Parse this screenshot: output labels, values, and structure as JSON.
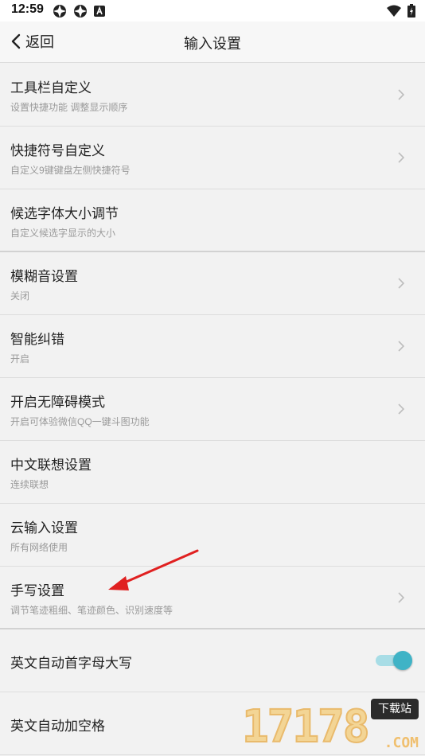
{
  "status_bar": {
    "time": "12:59"
  },
  "nav": {
    "back_label": "返回",
    "title": "输入设置"
  },
  "rows": [
    {
      "title": "工具栏自定义",
      "subtitle": "设置快捷功能 调整显示顺序"
    },
    {
      "title": "快捷符号自定义",
      "subtitle": "自定义9键键盘左侧快捷符号"
    },
    {
      "title": "候选字体大小调节",
      "subtitle": "自定义候选字显示的大小"
    },
    {
      "title": "模糊音设置",
      "subtitle": "关闭"
    },
    {
      "title": "智能纠错",
      "subtitle": "开启"
    },
    {
      "title": "开启无障碍模式",
      "subtitle": "开启可体验微信QQ一键斗图功能"
    },
    {
      "title": "中文联想设置",
      "subtitle": "连续联想"
    },
    {
      "title": "云输入设置",
      "subtitle": "所有网络使用"
    },
    {
      "title": "手写设置",
      "subtitle": "调节笔迹粗细、笔迹颜色、识别速度等"
    },
    {
      "title": "英文自动首字母大写",
      "toggle_on": true
    },
    {
      "title": "英文自动加空格"
    }
  ],
  "watermark": {
    "digits": "17178",
    "badge": "下载站",
    "suffix": ".COM"
  },
  "colors": {
    "accent": "#3fb3c6",
    "arrow": "#e02020"
  }
}
